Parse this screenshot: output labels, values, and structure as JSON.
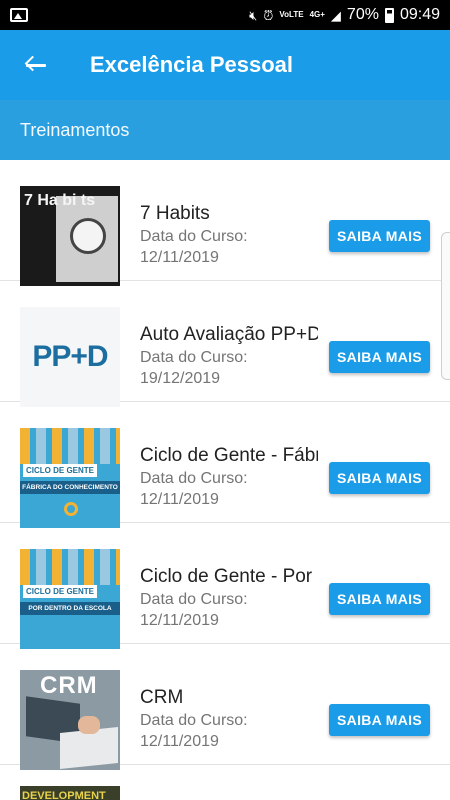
{
  "status_bar": {
    "signal_label": "VoLTE",
    "network_label": "4G+",
    "battery": "70%",
    "time": "09:49"
  },
  "app_bar": {
    "title": "Excelência Pessoal"
  },
  "section": {
    "title": "Treinamentos"
  },
  "courses": [
    {
      "name": "7 Habits",
      "label": "Data do Curso:",
      "date": "12/11/2019",
      "button": "SAIBA MAIS",
      "thumb_text": "7 Ha bi ts"
    },
    {
      "name": "Auto Avaliação PP+D",
      "label": "Data do Curso:",
      "date": "19/12/2019",
      "button": "SAIBA MAIS",
      "thumb_text": "PP+D"
    },
    {
      "name": "Ciclo de Gente - Fábrica do Conhecimento",
      "label": "Data do Curso:",
      "date": "12/11/2019",
      "button": "SAIBA MAIS",
      "thumb_text_1": "CICLO DE GENTE",
      "thumb_text_2": "FÁBRICA DO CONHECIMENTO"
    },
    {
      "name": "Ciclo de Gente - Por Dentro da Escola",
      "label": "Data do Curso:",
      "date": "12/11/2019",
      "button": "SAIBA MAIS",
      "thumb_text_1": "CICLO DE GENTE",
      "thumb_text_2": "POR DENTRO DA ESCOLA"
    },
    {
      "name": "CRM",
      "label": "Data do Curso:",
      "date": "12/11/2019",
      "button": "SAIBA MAIS",
      "thumb_text": "CRM"
    }
  ],
  "partial_item": {
    "thumb_text": "DEVELOPMENT"
  }
}
